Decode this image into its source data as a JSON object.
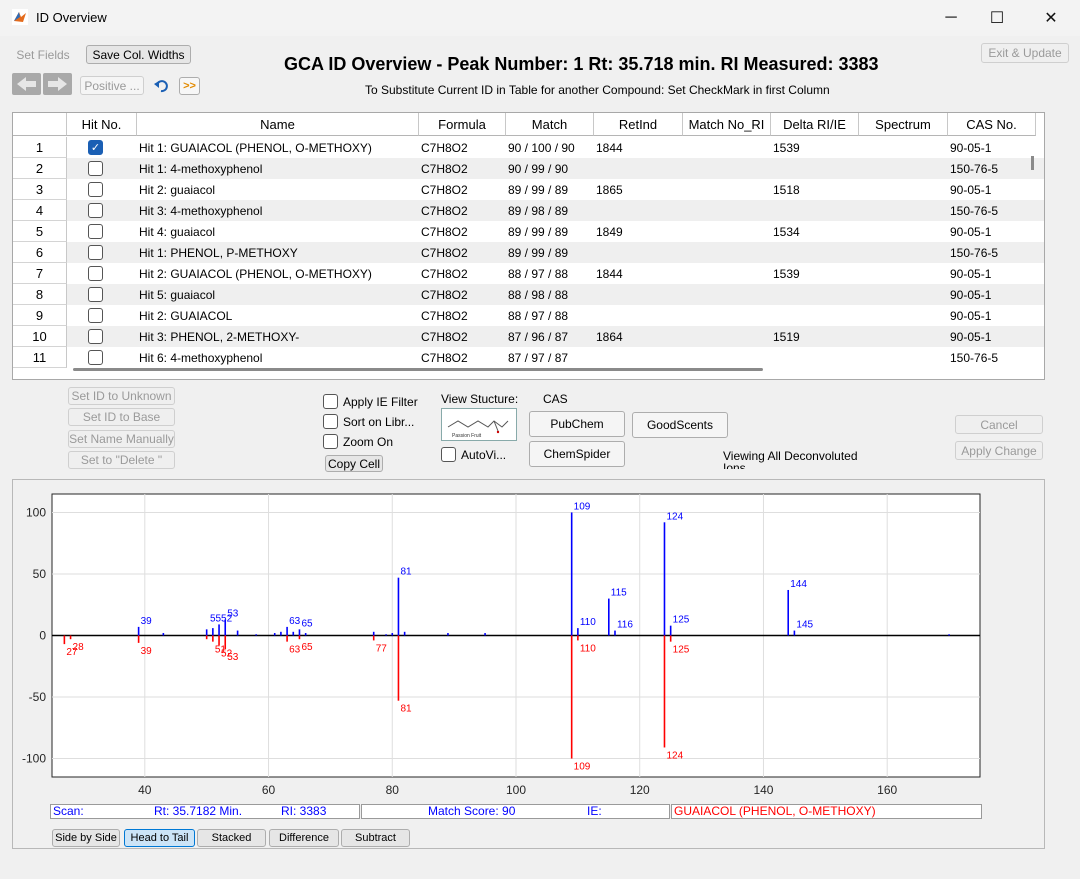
{
  "window": {
    "title": "ID Overview",
    "min_icon": "minimize-icon",
    "max_icon": "maximize-icon",
    "close_icon": "close-icon"
  },
  "toolbar": {
    "set_fields": "Set Fields",
    "save_col_widths": "Save Col. Widths",
    "positive": "Positive ...",
    "forward": ">>",
    "exit_update": "Exit & Update"
  },
  "header": {
    "title": "GCA ID Overview - Peak Number: 1  Rt: 35.718 min.  RI Measured: 3383",
    "subtitle": "To Substitute Current ID in Table for another Compound: Set CheckMark in first Column"
  },
  "table": {
    "columns": [
      "Hit No.",
      "Name",
      "Formula",
      "Match",
      "RetInd",
      "Match No_RI",
      "Delta RI/IE",
      "Spectrum",
      "CAS No."
    ],
    "rows": [
      {
        "num": "1",
        "checked": true,
        "name": "Hit  1: GUAIACOL (PHENOL, O-METHOXY)",
        "formula": "C7H8O2",
        "match": "90 / 100 / 90",
        "retind": "1844",
        "match_no_ri": "",
        "delta": "1539",
        "spectrum": "",
        "cas": "90-05-1"
      },
      {
        "num": "2",
        "checked": false,
        "name": "Hit  1: 4-methoxyphenol",
        "formula": "C7H8O2",
        "match": "90 / 99 / 90",
        "retind": "",
        "match_no_ri": "",
        "delta": "",
        "spectrum": "",
        "cas": "150-76-5"
      },
      {
        "num": "3",
        "checked": false,
        "name": "Hit  2: guaiacol",
        "formula": "C7H8O2",
        "match": "89 / 99 / 89",
        "retind": "1865",
        "match_no_ri": "",
        "delta": "1518",
        "spectrum": "",
        "cas": "90-05-1"
      },
      {
        "num": "4",
        "checked": false,
        "name": "Hit  3: 4-methoxyphenol",
        "formula": "C7H8O2",
        "match": "89 / 98 / 89",
        "retind": "",
        "match_no_ri": "",
        "delta": "",
        "spectrum": "",
        "cas": "150-76-5"
      },
      {
        "num": "5",
        "checked": false,
        "name": "Hit  4: guaiacol",
        "formula": "C7H8O2",
        "match": "89 / 99 / 89",
        "retind": "1849",
        "match_no_ri": "",
        "delta": "1534",
        "spectrum": "",
        "cas": "90-05-1"
      },
      {
        "num": "6",
        "checked": false,
        "name": "Hit  1: PHENOL, P-METHOXY",
        "formula": "C7H8O2",
        "match": "89 / 99 / 89",
        "retind": "",
        "match_no_ri": "",
        "delta": "",
        "spectrum": "",
        "cas": "150-76-5"
      },
      {
        "num": "7",
        "checked": false,
        "name": "Hit  2: GUAIACOL (PHENOL, O-METHOXY)",
        "formula": "C7H8O2",
        "match": "88 / 97 / 88",
        "retind": "1844",
        "match_no_ri": "",
        "delta": "1539",
        "spectrum": "",
        "cas": "90-05-1"
      },
      {
        "num": "8",
        "checked": false,
        "name": "Hit  5: guaiacol",
        "formula": "C7H8O2",
        "match": "88 / 98 / 88",
        "retind": "",
        "match_no_ri": "",
        "delta": "",
        "spectrum": "",
        "cas": "90-05-1"
      },
      {
        "num": "9",
        "checked": false,
        "name": "Hit  2: GUAIACOL",
        "formula": "C7H8O2",
        "match": "88 / 97 / 88",
        "retind": "",
        "match_no_ri": "",
        "delta": "",
        "spectrum": "",
        "cas": "90-05-1"
      },
      {
        "num": "10",
        "checked": false,
        "name": "Hit  3: PHENOL, 2-METHOXY-",
        "formula": "C7H8O2",
        "match": "87 / 96 / 87",
        "retind": "1864",
        "match_no_ri": "",
        "delta": "1519",
        "spectrum": "",
        "cas": "90-05-1"
      },
      {
        "num": "11",
        "checked": false,
        "name": "Hit  6: 4-methoxyphenol",
        "formula": "C7H8O2",
        "match": "87 / 97 / 87",
        "retind": "",
        "match_no_ri": "",
        "delta": "",
        "spectrum": "",
        "cas": "150-76-5"
      }
    ]
  },
  "actions": {
    "set_unknown": "Set ID to Unknown",
    "set_base": "Set ID to Base",
    "set_name": "Set Name Manually",
    "set_delete": "Set to \"Delete \"",
    "apply_ie": "Apply IE Filter",
    "sort_libr": "Sort on Libr...",
    "zoom_on": "Zoom On",
    "copy_cell": "Copy Cell",
    "view_structure": "View Stucture:",
    "cas": "CAS",
    "pubchem": "PubChem",
    "goodscents": "GoodScents",
    "chemspider": "ChemSpider",
    "autovi": "AutoVi...",
    "viewing": "Viewing All Deconvoluted",
    "viewing2": "Ions",
    "cancel": "Cancel",
    "apply_change": "Apply Change",
    "thumb_caption": "Passion Fruit"
  },
  "status": {
    "scan": "Scan:",
    "rt": "Rt: 35.7182 Min.",
    "ri": "RI: 3383",
    "match": "Match Score: 90",
    "ie": "IE:",
    "compound": "GUAIACOL (PHENOL, O-METHOXY)"
  },
  "modes": [
    "Side by Side",
    "Head to Tail",
    "Stacked",
    "Difference",
    "Subtract"
  ],
  "colors": {
    "top": "#0000ff",
    "bottom": "#ff0000",
    "selected_blue": "#1a5fb4",
    "status_red": "#ff0000"
  },
  "chart_data": {
    "type": "bar",
    "mode": "head-to-tail",
    "xlim": [
      25,
      175
    ],
    "ylim": [
      -115,
      115
    ],
    "xticks": [
      40,
      60,
      80,
      100,
      120,
      140,
      160
    ],
    "yticks": [
      100,
      50,
      0,
      -50,
      -100
    ],
    "grid": true,
    "series": [
      {
        "peaks": [
          {
            "x": 39,
            "y": 7,
            "label": "39"
          },
          {
            "x": 43,
            "y": 2
          },
          {
            "x": 50,
            "y": 5
          },
          {
            "x": 51,
            "y": 6
          },
          {
            "x": 52,
            "y": 9,
            "label": "52"
          },
          {
            "x": 53,
            "y": 13,
            "label": "53"
          },
          {
            "x": 55,
            "y": 4
          },
          {
            "x": 58,
            "y": 1
          },
          {
            "x": 61,
            "y": 2
          },
          {
            "x": 62,
            "y": 3
          },
          {
            "x": 63,
            "y": 7,
            "label": "63"
          },
          {
            "x": 64,
            "y": 3
          },
          {
            "x": 65,
            "y": 5,
            "label": "65"
          },
          {
            "x": 66,
            "y": 2
          },
          {
            "x": 77,
            "y": 3
          },
          {
            "x": 79,
            "y": 1
          },
          {
            "x": 80,
            "y": 2
          },
          {
            "x": 81,
            "y": 47,
            "label": "81"
          },
          {
            "x": 82,
            "y": 3
          },
          {
            "x": 89,
            "y": 2
          },
          {
            "x": 95,
            "y": 2
          },
          {
            "x": 109,
            "y": 100,
            "label": "109"
          },
          {
            "x": 110,
            "y": 6,
            "label": "110"
          },
          {
            "x": 115,
            "y": 30,
            "label": "115"
          },
          {
            "x": 116,
            "y": 4,
            "label": "116"
          },
          {
            "x": 124,
            "y": 92,
            "label": "124"
          },
          {
            "x": 125,
            "y": 8,
            "label": "125"
          },
          {
            "x": 144,
            "y": 37,
            "label": "144"
          },
          {
            "x": 145,
            "y": 4,
            "label": "145"
          },
          {
            "x": 170,
            "y": 1
          }
        ],
        "extra_labels": [
          {
            "x": 51.5,
            "text": "55",
            "dx": -6
          }
        ]
      },
      {
        "peaks": [
          {
            "x": 27,
            "y": -7,
            "label": "27"
          },
          {
            "x": 28,
            "y": -3,
            "label": "28"
          },
          {
            "x": 39,
            "y": -6,
            "label": "39"
          },
          {
            "x": 50,
            "y": -3
          },
          {
            "x": 51,
            "y": -5,
            "label": "51"
          },
          {
            "x": 52,
            "y": -8,
            "label": "52"
          },
          {
            "x": 53,
            "y": -11,
            "label": "53"
          },
          {
            "x": 63,
            "y": -5,
            "label": "63"
          },
          {
            "x": 65,
            "y": -3,
            "label": "65"
          },
          {
            "x": 77,
            "y": -4,
            "label": "77"
          },
          {
            "x": 81,
            "y": -53,
            "label": "81"
          },
          {
            "x": 109,
            "y": -100,
            "label": "109"
          },
          {
            "x": 110,
            "y": -4,
            "label": "110"
          },
          {
            "x": 124,
            "y": -91,
            "label": "124"
          },
          {
            "x": 125,
            "y": -5,
            "label": "125"
          }
        ]
      }
    ]
  }
}
